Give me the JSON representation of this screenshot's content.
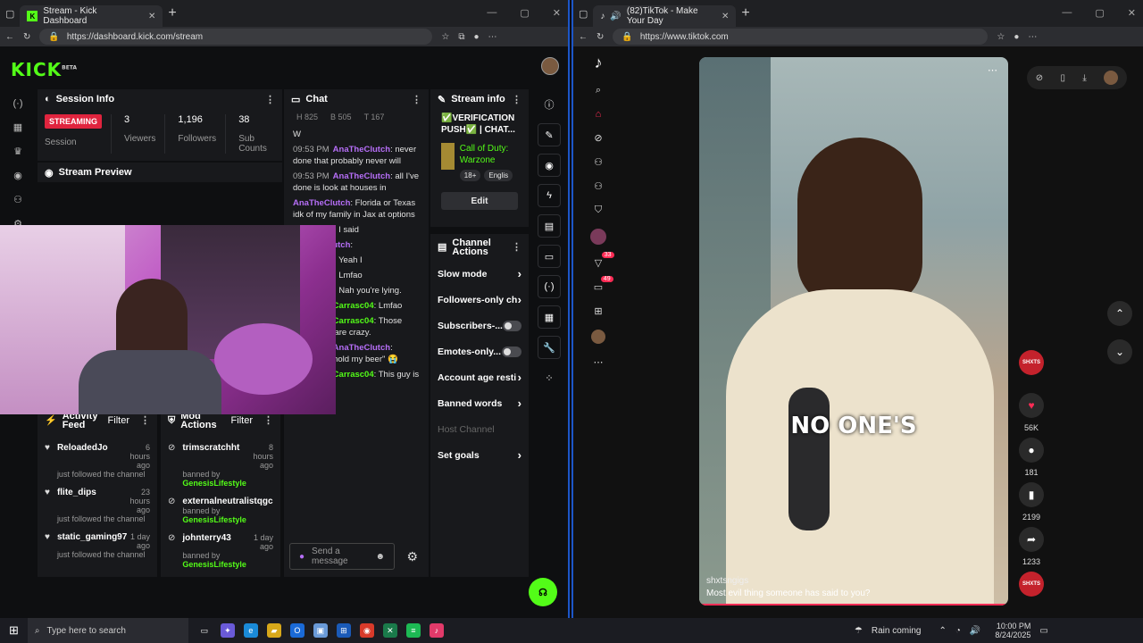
{
  "left_browser": {
    "tab_title": "Stream - Kick Dashboard",
    "url": "https://dashboard.kick.com/stream"
  },
  "right_browser": {
    "tab_title": "(82)TikTok - Make Your Day",
    "url": "https://www.tiktok.com"
  },
  "kick": {
    "logo": "KICK",
    "logo_badge": "BETA",
    "session": {
      "title": "Session Info",
      "status_badge": "STREAMING",
      "status_label": "Session",
      "viewers_value": "3",
      "viewers_label": "Viewers",
      "followers_value": "1,196",
      "followers_label": "Followers",
      "subs_value": "38",
      "subs_label": "Sub Counts"
    },
    "preview_title": "Stream Preview",
    "chat": {
      "title": "Chat",
      "top_counts": [
        "H 825",
        "B 505",
        "T 167"
      ],
      "messages": [
        {
          "time": "",
          "user": "",
          "text": "W",
          "color": "g"
        },
        {
          "time": "09:53 PM",
          "user": "AnaTheClutch",
          "text": "never done that probably never will",
          "color": "p"
        },
        {
          "time": "09:53 PM",
          "user": "AnaTheClutch",
          "text": "all I've done is look at houses in",
          "color": "p"
        },
        {
          "time": "",
          "user": "AnaTheClutch",
          "text": "Florida or Texas idk of my family in Jax at options",
          "color": "p"
        },
        {
          "time": "",
          "user": "Carrasc04",
          "text": "I said",
          "color": "g"
        },
        {
          "time": "",
          "user": "AnaTheClutch",
          "text": "",
          "color": "p"
        },
        {
          "time": "",
          "user": "Carrasc04",
          "text": "Yeah I",
          "color": "g"
        },
        {
          "time": "",
          "user": "Carrasc04",
          "text": "Lmfao",
          "color": "g"
        },
        {
          "time": "",
          "user": "Carrasc04",
          "text": "Nah you're lying.",
          "color": "g"
        },
        {
          "time": "09:56 PM",
          "user": "Carrasc04",
          "text": "Lmfao",
          "color": "g"
        },
        {
          "time": "09:57 PM",
          "user": "Carrasc04",
          "text": "Those comments are crazy.",
          "color": "g"
        },
        {
          "time": "09:57 PM",
          "user": "AnaTheClutch",
          "text": "activision \"hold my beer\" 😭",
          "color": "p"
        },
        {
          "time": "09:59 PM",
          "user": "Carrasc04",
          "text": "This guy is funny.",
          "color": "g"
        }
      ],
      "input_placeholder": "Send a message"
    },
    "stream_info": {
      "title": "Stream info",
      "stream_title": "✅VERIFICATION PUSH✅ | CHAT...",
      "category": "Call of Duty: Warzone",
      "tag1": "18+",
      "tag2": "Englis",
      "edit_label": "Edit"
    },
    "channel_actions": {
      "title": "Channel Actions",
      "items": [
        {
          "label": "Slow mode",
          "kind": "chev"
        },
        {
          "label": "Followers-only ch",
          "kind": "chev"
        },
        {
          "label": "Subscribers-...",
          "kind": "toggle"
        },
        {
          "label": "Emotes-only...",
          "kind": "toggle"
        },
        {
          "label": "Account age resti",
          "kind": "chev"
        },
        {
          "label": "Banned words",
          "kind": "chev"
        },
        {
          "label": "Host Channel",
          "kind": "disabled"
        },
        {
          "label": "Set goals",
          "kind": "chev"
        }
      ]
    },
    "activity": {
      "title": "Activity Feed",
      "filter": "Filter",
      "items": [
        {
          "name": "ReloadedJo",
          "time": "6 hours ago",
          "sub": "just followed the channel"
        },
        {
          "name": "flite_dips",
          "time": "23 hours ago",
          "sub": "just followed the channel"
        },
        {
          "name": "static_gaming97",
          "time": "1 day ago",
          "sub": "just followed the channel"
        }
      ]
    },
    "mod": {
      "title": "Mod Actions",
      "filter": "Filter",
      "items": [
        {
          "name": "trimscratchht",
          "time": "8 hours ago",
          "sub": "banned by",
          "by": "GenesisLifestyle"
        },
        {
          "name": "externalneutralistqgc",
          "time": "",
          "sub": "banned by",
          "by": "GenesisLifestyle"
        },
        {
          "name": "johnterry43",
          "time": "1 day ago",
          "sub": "banned by",
          "by": "GenesisLifestyle"
        }
      ]
    }
  },
  "tiktok": {
    "caption_user": "shxtsngigs",
    "caption_text": "Most evil thing someone has said to you?",
    "overlay_text": "NO ONE'S",
    "likes": "56K",
    "comments": "181",
    "saves": "2199",
    "shares": "1233",
    "badge_inbox": "33",
    "badge_msgs": "49"
  },
  "taskbar": {
    "search_placeholder": "Type here to search",
    "weather": "Rain coming",
    "time": "10:00 PM",
    "date": "8/24/2025"
  }
}
